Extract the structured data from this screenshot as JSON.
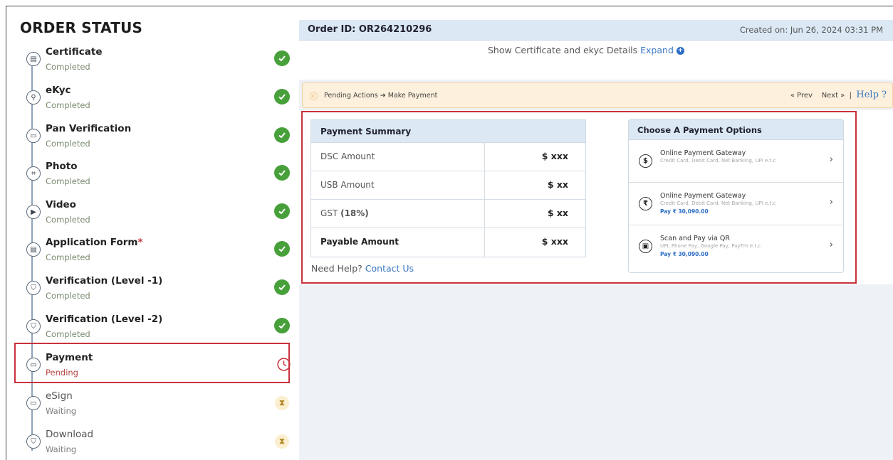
{
  "sidebar": {
    "title": "ORDER STATUS",
    "steps": [
      {
        "label": "Certificate",
        "status": "Completed",
        "state": "done",
        "icon": "certificate-icon"
      },
      {
        "label": "eKyc",
        "status": "Completed",
        "state": "done",
        "icon": "magnifier-icon"
      },
      {
        "label": "Pan Verification",
        "status": "Completed",
        "state": "done",
        "icon": "card-icon"
      },
      {
        "label": "Photo",
        "status": "Completed",
        "state": "done",
        "icon": "face-scan-icon"
      },
      {
        "label": "Video",
        "status": "Completed",
        "state": "done",
        "icon": "video-icon"
      },
      {
        "label": "Application Form",
        "required_mark": "*",
        "status": "Completed",
        "state": "done",
        "icon": "document-icon"
      },
      {
        "label": "Verification (Level -1)",
        "status": "Completed",
        "state": "done",
        "icon": "shield-icon"
      },
      {
        "label": "Verification (Level -2)",
        "status": "Completed",
        "state": "done",
        "icon": "shield-icon"
      },
      {
        "label": "Payment",
        "status": "Pending",
        "state": "pending",
        "icon": "card-icon"
      },
      {
        "label": "eSign",
        "status": "Waiting",
        "state": "waiting",
        "icon": "card-icon"
      },
      {
        "label": "Download",
        "status": "Waiting",
        "state": "waiting",
        "icon": "shield-icon"
      }
    ]
  },
  "header": {
    "order_id": "Order ID: OR264210296",
    "created": "Created on: Jun 26, 2024 03:31 PM"
  },
  "certificate_row": {
    "text": "Show Certificate and ekyc Details",
    "link": "Expand",
    "icon": "plus-circle-icon"
  },
  "pending_bar": {
    "text": "Pending Actions ➔ Make Payment",
    "prev": "« Prev",
    "next": "Next »",
    "separator": "|",
    "help": "Help ?"
  },
  "payment_summary": {
    "title": "Payment Summary",
    "rows": [
      {
        "label": "DSC Amount",
        "value": "$ xxx"
      },
      {
        "label": "USB Amount",
        "value": "$ xx"
      },
      {
        "label": "GST",
        "label_bold": "(18%)",
        "value": "$ xx"
      },
      {
        "label": "Payable Amount",
        "value": "$ xxx"
      }
    ],
    "help_text": "Need Help?",
    "help_link": "Contact Us"
  },
  "payment_options": {
    "title": "Choose A Payment Options",
    "options": [
      {
        "title": "Online Payment Gateway",
        "subtitle": "Credit Card, Debit Card, Net Banking, UPI e.t.c",
        "pay": "",
        "icon": "dollar-icon",
        "icon_glyph": "$"
      },
      {
        "title": "Online Payment Gateway",
        "subtitle": "Credit Card, Debit Card, Net Banking, UPI e.t.c",
        "pay": "Pay ₹ 30,090.00",
        "icon": "rupee-icon",
        "icon_glyph": "₹"
      },
      {
        "title": "Scan and Pay via QR",
        "subtitle": "UPI, Phone Pay, Google Pay, PayTm e.t.c",
        "pay": "Pay ₹ 30,090.00",
        "icon": "qr-icon",
        "icon_glyph": "▣"
      }
    ]
  },
  "colors": {
    "highlight": "#c8323c",
    "success": "#47a03a",
    "link": "#3a78c2",
    "header_bg": "#dce9f5",
    "pending_bg": "#fdf0dc"
  }
}
